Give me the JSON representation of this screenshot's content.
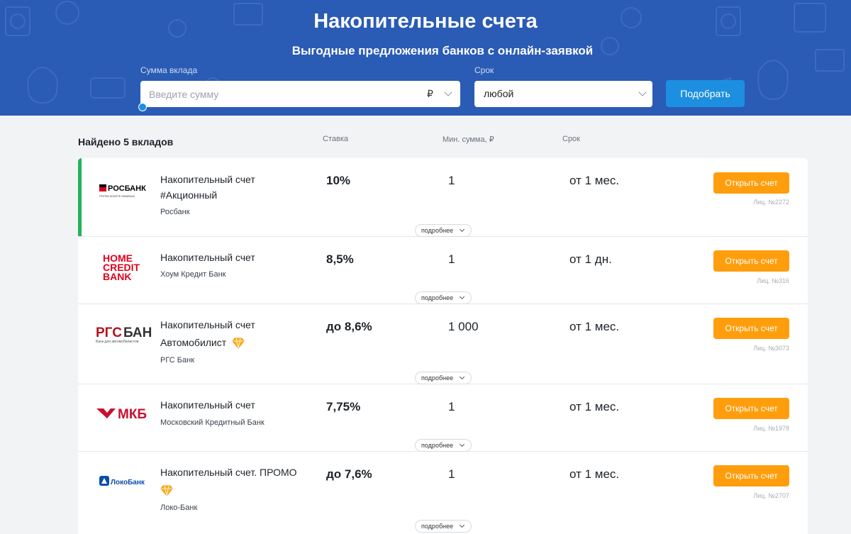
{
  "header": {
    "title": "Накопительные счета",
    "subtitle": "Выгодные предложения банков с онлайн-заявкой",
    "amount_label": "Сумма вклада",
    "amount_placeholder": "Введите сумму",
    "currency_symbol": "₽",
    "term_label": "Срок",
    "term_value": "любой",
    "search_button": "Подобрать",
    "bg_color": "#2a5bb5"
  },
  "results": {
    "found_text": "Найдено 5 вкладов",
    "columns": {
      "rate": "Ставка",
      "min_sum": "Мин. сумма, ₽",
      "term": "Срок"
    },
    "open_label": "Открыть счет",
    "more_label": "подробнее",
    "items": [
      {
        "name": "Накопительный счет",
        "name2": "#Акционный",
        "bank": "Росбанк",
        "rate": "10%",
        "min_sum": "1",
        "term": "от 1 мес.",
        "license": "Лиц. №2272",
        "logo": "РОСБАНК",
        "logo_sub": "ГРУППА SOCIETE GENERALE",
        "highlighted": true
      },
      {
        "name": "Накопительный счет",
        "bank": "Хоум Кредит Банк",
        "rate": "8,5%",
        "min_sum": "1",
        "term": "от 1 дн.",
        "license": "Лиц. №316",
        "logo": "HOME CREDIT BANK"
      },
      {
        "name": "Накопительный счет",
        "name2": "Автомобилист",
        "bank": "РГС Банк",
        "rate": "до 8,6%",
        "min_sum": "1 000",
        "term": "от 1 мес.",
        "license": "Лиц. №3073",
        "logo": "РГСБАНК",
        "logo_sub": "Банк для автомобилистов",
        "premium": true
      },
      {
        "name": "Накопительный счет",
        "bank": "Московский Кредитный Банк",
        "rate": "7,75%",
        "min_sum": "1",
        "term": "от 1 мес.",
        "license": "Лиц. №1978",
        "logo": "МКБ"
      },
      {
        "name": "Накопительный счет. ПРОМО",
        "bank": "Локо-Банк",
        "rate": "до 7,6%",
        "min_sum": "1",
        "term": "от 1 мес.",
        "license": "Лиц. №2707",
        "logo": "ЛокоБанк",
        "premium": true
      }
    ]
  },
  "colors": {
    "accent_green": "#22b35b",
    "open_button": "#ff9e0d",
    "search_button": "#1d8fe0"
  }
}
